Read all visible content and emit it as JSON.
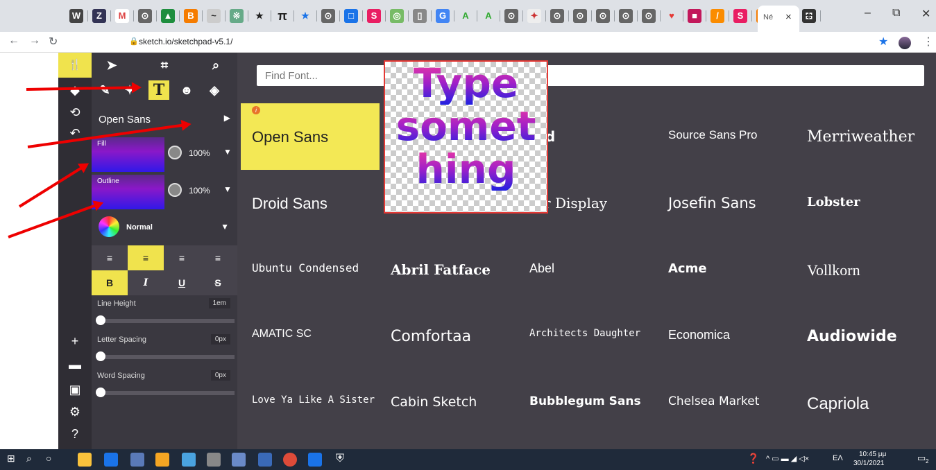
{
  "browser": {
    "active_tab_title": "Né",
    "url": "sketch.io/sketchpad-v5.1/",
    "new_tab": "+",
    "tab_close": "×"
  },
  "tool_rows": {
    "row1": [
      "select-arrow",
      "crop",
      "zoom"
    ],
    "row2": [
      "brush",
      "pin",
      "T",
      "emoji",
      "fill"
    ]
  },
  "text_panel": {
    "font_name": "Open Sans",
    "fill_label": "Fill",
    "fill_opacity": "100%",
    "outline_label": "Outline",
    "outline_opacity": "100%",
    "blend_mode": "Normal",
    "style_bold": "B",
    "style_italic": "I",
    "style_underline": "U",
    "style_strike": "S",
    "line_height_label": "Line Height",
    "line_height_value": "1em",
    "letter_spacing_label": "Letter Spacing",
    "letter_spacing_value": "0px",
    "word_spacing_label": "Word Spacing",
    "word_spacing_value": "0px"
  },
  "font_browser": {
    "search_placeholder": "Find Font...",
    "selected_font": "Open Sans",
    "fonts": [
      [
        "Open Sans",
        "",
        "wald",
        "Source Sans Pro",
        "Merriweather"
      ],
      [
        "Droid Sans",
        "",
        "yfair Display",
        "Josefin Sans",
        "Lobster"
      ],
      [
        "Ubuntu Condensed",
        "Abril Fatface",
        "Abel",
        "Acme",
        "Vollkorn"
      ],
      [
        "AMATIC SC",
        "Comfortaa",
        "Architects Daughter",
        "Economica",
        "Audiowide"
      ],
      [
        "Love Ya Like A Sister",
        "Cabin Sketch",
        "Bubblegum Sans",
        "Chelsea Market",
        "Capriola"
      ]
    ]
  },
  "preview": {
    "lines": [
      "Type",
      "somet",
      "hing"
    ]
  },
  "taskbar": {
    "time": "10:45 μμ",
    "date": "30/1/2021",
    "lang": "ΕΛ",
    "notif_count": "2"
  }
}
